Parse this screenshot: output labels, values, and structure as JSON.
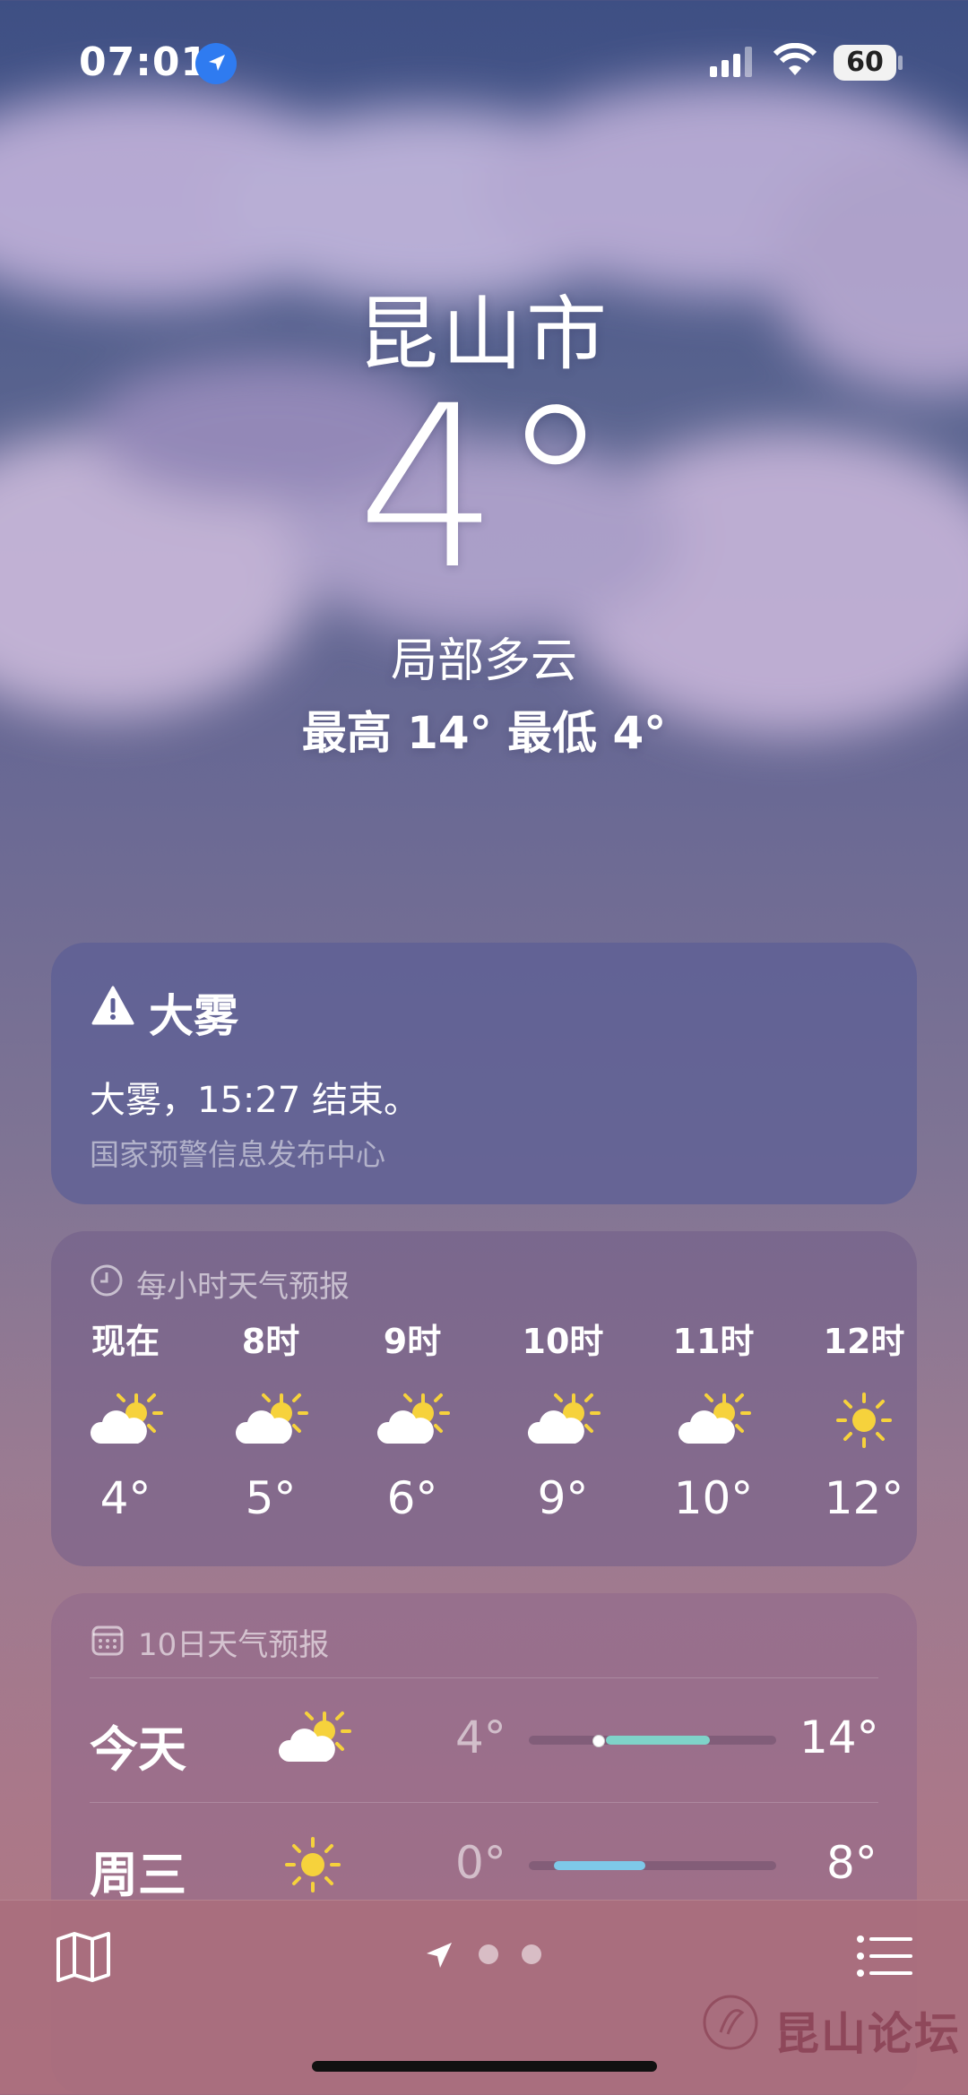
{
  "status": {
    "time": "07:01",
    "battery": "60"
  },
  "location": {
    "city": "昆山市",
    "temp": "4°",
    "condition": "局部多云",
    "hilo": "最高 14°  最低 4°"
  },
  "alert": {
    "title": "大雾",
    "body": "大雾，15:27 结束。",
    "source": "国家预警信息发布中心"
  },
  "hourly": {
    "title": "每小时天气预报",
    "items": [
      {
        "time": "现在",
        "icon": "partly-cloudy-icon",
        "temp": "4°"
      },
      {
        "time": "8时",
        "icon": "partly-cloudy-icon",
        "temp": "5°"
      },
      {
        "time": "9时",
        "icon": "partly-cloudy-icon",
        "temp": "6°"
      },
      {
        "time": "10时",
        "icon": "partly-cloudy-icon",
        "temp": "9°"
      },
      {
        "time": "11时",
        "icon": "partly-cloudy-icon",
        "temp": "10°"
      },
      {
        "time": "12时",
        "icon": "sun-icon",
        "temp": "12°"
      }
    ]
  },
  "daily": {
    "title": "10日天气预报",
    "days": [
      {
        "name": "今天",
        "icon": "partly-cloudy-icon",
        "low": "4°",
        "high": "14°"
      },
      {
        "name": "周三",
        "icon": "sun-icon",
        "low": "0°",
        "high": "8°"
      }
    ]
  },
  "bottom": {
    "watermark": "昆山论坛"
  },
  "colors": {
    "bar_today": "#7fd3c9",
    "bar_wed": "#7ec9e8",
    "sun": "#f6d23c",
    "alert_bg": "#5c5e96"
  }
}
